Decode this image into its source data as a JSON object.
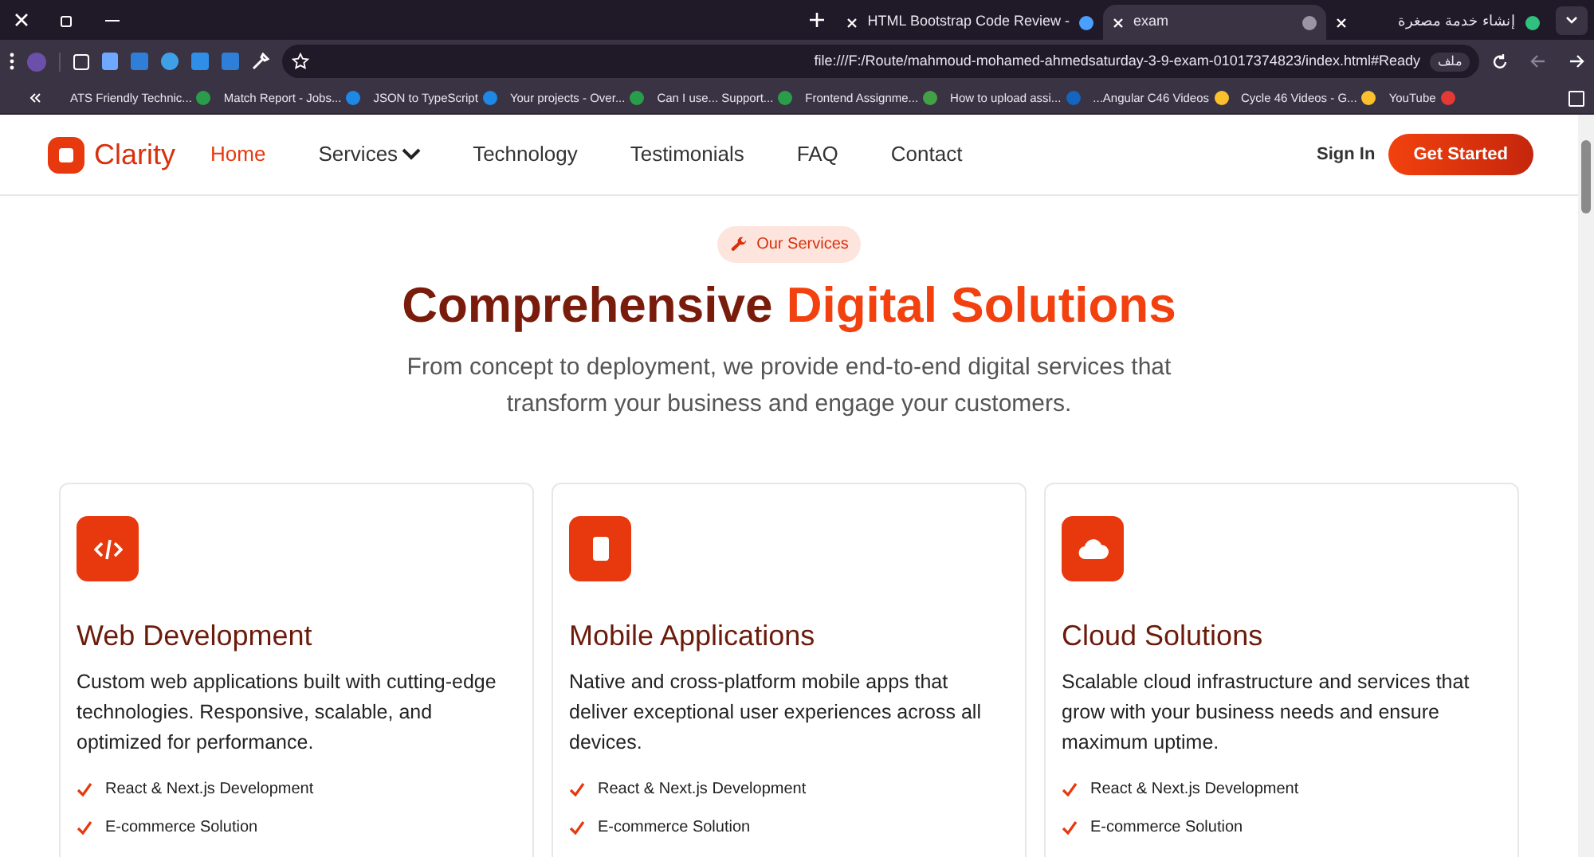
{
  "browser": {
    "tabs": [
      {
        "title": "HTML Bootstrap Code Review -",
        "selected": false
      },
      {
        "title": "exam",
        "selected": true
      },
      {
        "title": "إنشاء خدمة مصغرة",
        "selected": false
      }
    ],
    "url": "file:///F:/Route/mahmoud-mohamed-ahmedsaturday-3-9-exam-01017374823/index.html#Ready",
    "url_chip": "ملف",
    "bookmarks": [
      "ATS Friendly Technic...",
      "Match Report - Jobs...",
      "JSON to TypeScript",
      "Your projects - Over...",
      "Can I use... Support...",
      "Frontend Assignme...",
      "How to upload assi...",
      "...Angular C46 Videos",
      "Cycle 46 Videos - G...",
      "YouTube"
    ]
  },
  "navbar": {
    "brand": "Clarity",
    "links": [
      {
        "label": "Home",
        "selected": true,
        "dropdown": false
      },
      {
        "label": "Services",
        "selected": false,
        "dropdown": true
      },
      {
        "label": "Technology",
        "selected": false,
        "dropdown": false
      },
      {
        "label": "Testimonials",
        "selected": false,
        "dropdown": false
      },
      {
        "label": "FAQ",
        "selected": false,
        "dropdown": false
      },
      {
        "label": "Contact",
        "selected": false,
        "dropdown": false
      }
    ],
    "sign_in": "Sign In",
    "cta": "Get Started"
  },
  "section": {
    "badge": "Our Services",
    "title_dark": "Comprehensive",
    "title_accent": "Digital Solutions",
    "subtitle": "From concept to deployment, we provide end-to-end digital services that transform your business and engage your customers."
  },
  "cards": [
    {
      "kind": "code",
      "title": "Web Development",
      "text": "Custom web applications built with cutting-edge technologies. Responsive, scalable, and optimized for performance.",
      "features": [
        "React & Next.js Development",
        "E-commerce Solution"
      ]
    },
    {
      "kind": "mobile",
      "title": "Mobile Applications",
      "text": "Native and cross-platform mobile apps that deliver exceptional user experiences across all devices.",
      "features": [
        "React & Next.js Development",
        "E-commerce Solution"
      ]
    },
    {
      "kind": "cloud",
      "title": "Cloud Solutions",
      "text": "Scalable cloud infrastructure and services that grow with your business needs and ensure maximum uptime.",
      "features": [
        "React & Next.js Development",
        "E-commerce Solution"
      ]
    }
  ]
}
